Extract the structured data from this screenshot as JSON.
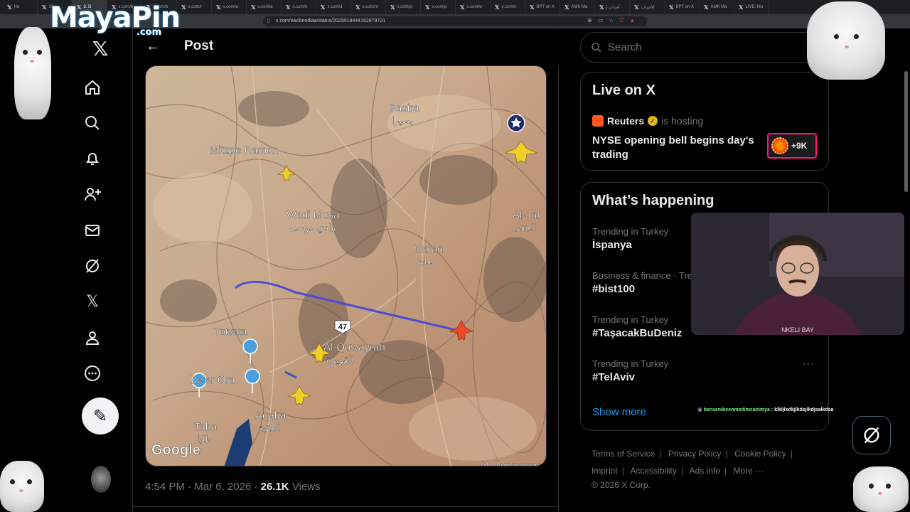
{
  "browser": {
    "tabs": [
      {
        "label": "Ho",
        "active": false
      },
      {
        "label": "Sh",
        "active": false
      },
      {
        "label": "3. D",
        "active": true
      },
      {
        "label": "x.com/b",
        "active": false
      },
      {
        "label": "x.com/b",
        "active": false
      },
      {
        "label": "x.com/r",
        "active": false
      },
      {
        "label": "x.com/w",
        "active": false
      },
      {
        "label": "x.com/a",
        "active": false
      },
      {
        "label": "x.com/n",
        "active": false
      },
      {
        "label": "x.com/d",
        "active": false
      },
      {
        "label": "x.com/m",
        "active": false
      },
      {
        "label": "x.com/p",
        "active": false
      },
      {
        "label": "x.com/p",
        "active": false
      },
      {
        "label": "x.com/w",
        "active": false
      },
      {
        "label": "x.com/s",
        "active": false
      },
      {
        "label": "BPT on X",
        "active": false
      },
      {
        "label": "AMK Ma",
        "active": false
      },
      {
        "label": "أحداث إ",
        "active": false
      },
      {
        "label": "الأحداث",
        "active": false
      },
      {
        "label": "BPT on X",
        "active": false
      },
      {
        "label": "AMK Ma",
        "active": false
      },
      {
        "label": "LIVE: Mu",
        "active": false
      }
    ],
    "url": "x.com/ww3mediaa/status/2029918444162879721"
  },
  "overlay": {
    "logo": "MayaPin",
    "logo_suffix": ".com",
    "chat_user": "bensenibeenmedimcanimya",
    "chat_message": " : klkljlsdkjlkdsjlkdjsalkdsa"
  },
  "nav": {
    "items": [
      "x-logo-icon",
      "home-icon",
      "explore-icon",
      "notifications-icon",
      "follow-icon",
      "messages-icon",
      "grok-icon",
      "premium-icon",
      "profile-icon",
      "more-icon"
    ]
  },
  "post": {
    "header": "Post",
    "time": "4:54 PM",
    "date": "Mar 6, 2026",
    "views_count": "26.1K",
    "views_label": "Views",
    "map": {
      "labels": [
        {
          "en": "Basira",
          "ar": "بصيرا"
        },
        {
          "en": "Mitzpe Ramon",
          "ar": ""
        },
        {
          "en": "Wadi Musa",
          "ar": "وادي موسى"
        },
        {
          "en": "Ma'an",
          "ar": "معان"
        },
        {
          "en": "Al-Jaf",
          "ar": "الجفر"
        },
        {
          "en": "Yotvata",
          "ar": ""
        },
        {
          "en": "Al-Quwayrah",
          "ar": "القويرة"
        },
        {
          "en": "Be'er Ora",
          "ar": ""
        },
        {
          "en": "Aqaba",
          "ar": "العقبة"
        },
        {
          "en": "Taba",
          "ar": "طابا"
        }
      ],
      "road_sign": "47",
      "watermark": "Google",
      "bottom_label": "Al-Mudawwara"
    }
  },
  "search": {
    "placeholder": "Search"
  },
  "live": {
    "title": "Live on X",
    "host": "Reuters",
    "host_suffix": "is hosting",
    "event": "NYSE opening bell begins day's trading",
    "listeners": "+9K"
  },
  "trends": {
    "title": "What’s happening",
    "items": [
      {
        "category": "Trending in Turkey",
        "name": "İspanya"
      },
      {
        "category": "Business & finance · Tre",
        "name": "#bist100"
      },
      {
        "category": "Trending in Turkey",
        "name": "#TaşacakBuDeniz"
      },
      {
        "category": "Trending in Turkey",
        "name": "#TelAviv"
      }
    ],
    "show_more": "Show more"
  },
  "footer": {
    "links": [
      "Terms of Service",
      "Privacy Policy",
      "Cookie Policy",
      "Imprint",
      "Accessibility",
      "Ads info",
      "More ···"
    ],
    "copyright": "© 2026 X Corp."
  },
  "webcam": {
    "shirt_text": "NKELI BAY"
  },
  "colors": {
    "accent": "#1d9bf0",
    "live_border": "#f91880",
    "track": "#4b4bd6"
  }
}
